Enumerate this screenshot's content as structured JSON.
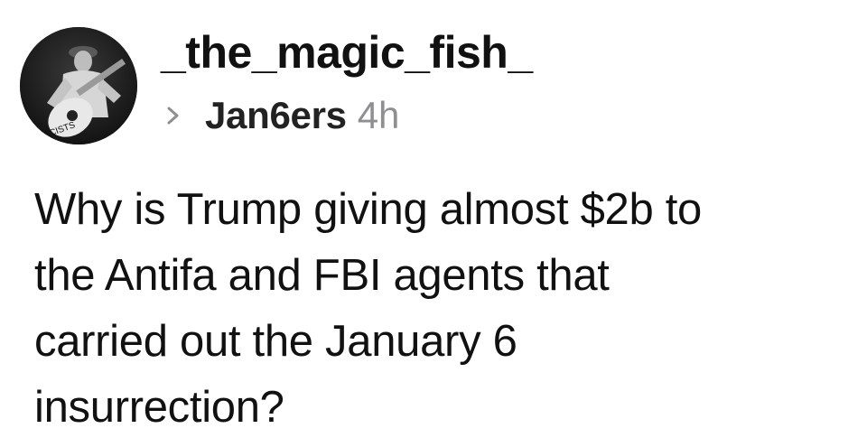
{
  "post": {
    "avatar_icon": "user-avatar-photo",
    "username": "_the_magic_fish_",
    "community": "Jan6ers",
    "time": "4h",
    "body_lines": [
      "Why is Trump giving almost $2b to",
      "the Antifa and FBI agents that",
      "carried out the January 6",
      "insurrection?"
    ]
  },
  "colors": {
    "text": "#111111",
    "muted": "#8e8e93",
    "background": "#ffffff"
  }
}
